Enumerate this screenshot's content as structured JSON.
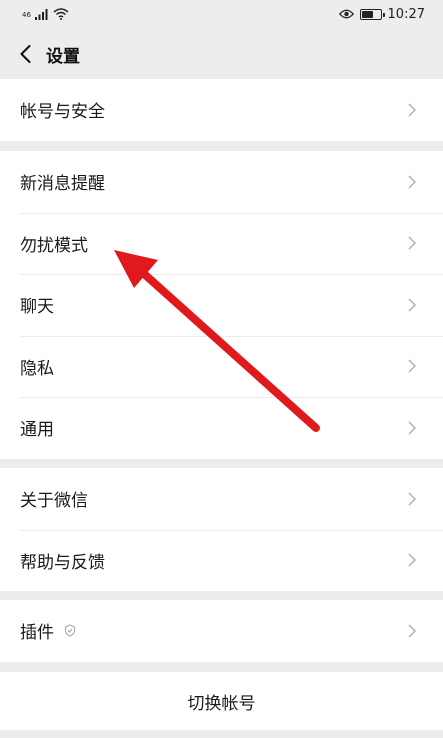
{
  "status_bar": {
    "signal_text": "46",
    "time": "10:27",
    "battery_level": 0.65,
    "icons": [
      "signal-icon",
      "wifi-icon",
      "eye-icon",
      "battery-icon"
    ]
  },
  "header": {
    "title": "设置",
    "back_icon": "chevron-left-icon"
  },
  "groups": {
    "account": {
      "items": [
        {
          "label": "帐号与安全"
        }
      ]
    },
    "settings": {
      "items": [
        {
          "label": "新消息提醒"
        },
        {
          "label": "勿扰模式"
        },
        {
          "label": "聊天"
        },
        {
          "label": "隐私"
        },
        {
          "label": "通用"
        }
      ]
    },
    "about": {
      "items": [
        {
          "label": "关于微信"
        },
        {
          "label": "帮助与反馈"
        }
      ]
    },
    "plugins": {
      "items": [
        {
          "label": "插件",
          "badge_icon": "shield-icon"
        }
      ]
    },
    "switch": {
      "label": "切换帐号"
    }
  },
  "annotation": {
    "arrow_color": "#e0191c"
  }
}
